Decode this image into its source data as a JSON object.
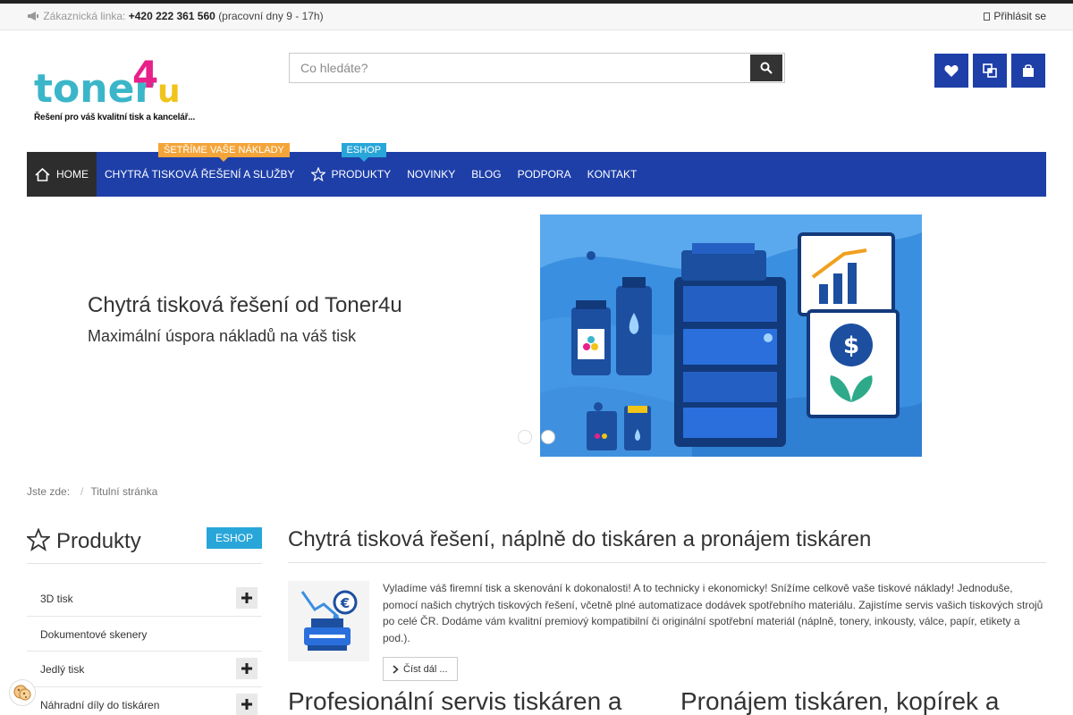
{
  "topbar": {
    "hotline_label": "Zákaznická linka:",
    "phone": "+420 222 361 560",
    "hours": "(pracovní dny 9 - 17h)",
    "login": "Přihlásit se"
  },
  "logo": {
    "text": "toner4u",
    "slogan": "Řešení pro váš kvalitní tisk a kancelář...",
    "colors": {
      "toner": "#3bb6c9",
      "four": "#e8208a",
      "u": "#f0c419"
    }
  },
  "search": {
    "placeholder": "Co hledáte?"
  },
  "header_buttons": [
    "heart-icon",
    "compare-icon",
    "bag-icon"
  ],
  "nav": {
    "items": [
      {
        "label": "Home",
        "icon": "home-icon",
        "active": true
      },
      {
        "label": "Chytrá tisková řešení a služby",
        "badge": "Šetříme vaše náklady"
      },
      {
        "label": "Produkty",
        "icon": "star-icon",
        "badge": "Eshop"
      },
      {
        "label": "Novinky"
      },
      {
        "label": "Blog"
      },
      {
        "label": "Podpora"
      },
      {
        "label": "Kontakt"
      }
    ]
  },
  "slider": {
    "title": "Chytrá tisková řešení od Toner4u",
    "subtitle": "Maximální úspora nákladů na váš tisk",
    "slide_count": 2,
    "active_slide": 2
  },
  "breadcrumb": {
    "label": "Jste zde:",
    "items": [
      "Titulní stránka"
    ]
  },
  "sidebar": {
    "title": "Produkty",
    "badge": "ESHOP",
    "categories": [
      {
        "name": "3D tisk",
        "expandable": true
      },
      {
        "name": "Dokumentové skenery",
        "expandable": false
      },
      {
        "name": "Jedlý tisk",
        "expandable": true
      },
      {
        "name": "Náhradní díly do tiskáren",
        "expandable": true
      }
    ]
  },
  "main": {
    "title": "Chytrá tisková řešení, náplně do tiskáren a pronájem tiskáren",
    "intro": "Vyladíme váš firemní tisk a skenování k dokonalosti! A to technicky i ekonomicky! Snížíme celkově vaše tiskové náklady! Jednoduše, pomocí našich chytrých tiskových řešení, včetně plné automatizace dodávek spotřebního materiálu. Zajistíme servis vašich tiskových strojů po celé ČR. Dodáme vám kvalitní premiový kompatibilní či originální spotřební materiál (náplně, tonery, inkousty, válce, papír, etikety a pod.).",
    "read_more": "Číst dál ...",
    "section_left": "Profesionální servis tiskáren a",
    "section_right": "Pronájem tiskáren, kopírek a"
  },
  "colors": {
    "primary": "#1e3fa8",
    "active_nav": "#2d2d2d",
    "badge_orange": "#f4a53a",
    "badge_teal": "#29a6d9"
  }
}
